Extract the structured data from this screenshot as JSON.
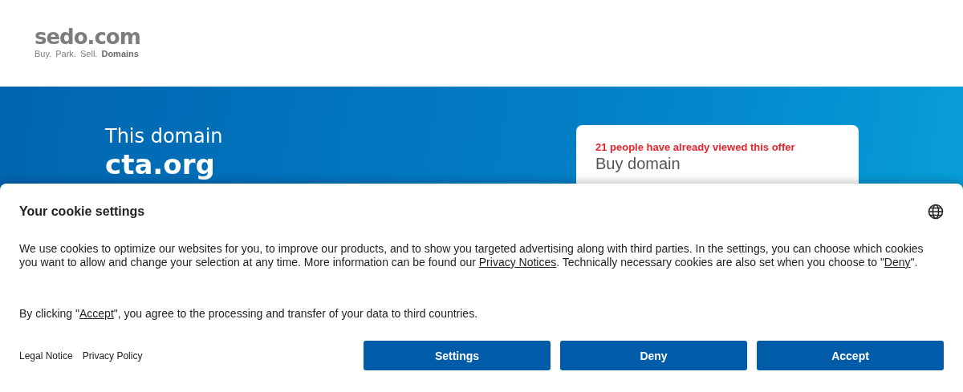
{
  "header": {
    "logo": "sedo.com",
    "tagline": "Buy. Park. Sell. **Domains**"
  },
  "hero": {
    "intro": "This domain",
    "domain": "cta.org",
    "offer_card": {
      "views_notice": "21 people have already viewed this offer",
      "title": "Buy domain"
    }
  },
  "cookie_banner": {
    "title": "Your cookie settings",
    "paragraphs": [
      [
        {
          "kind": "text",
          "text": "We use cookies to optimize our websites for you, to improve our products, and to show you targeted advertising along with third parties. In the settings, you can choose which cookies you want to allow and change your selection at any time. More information can be found our "
        },
        {
          "kind": "link",
          "text": "Privacy Notices"
        },
        {
          "kind": "text",
          "text": ". Technically necessary cookies are also set when you choose to \""
        },
        {
          "kind": "link",
          "text": "Deny"
        },
        {
          "kind": "text",
          "text": "\"."
        }
      ],
      [
        {
          "kind": "text",
          "text": "By clicking \""
        },
        {
          "kind": "link",
          "text": "Accept"
        },
        {
          "kind": "text",
          "text": "\", you agree to the processing and transfer of your data to third countries."
        }
      ]
    ],
    "footer_links": [
      "Legal Notice",
      "Privacy Policy"
    ],
    "buttons": [
      "Settings",
      "Deny",
      "Accept"
    ]
  }
}
